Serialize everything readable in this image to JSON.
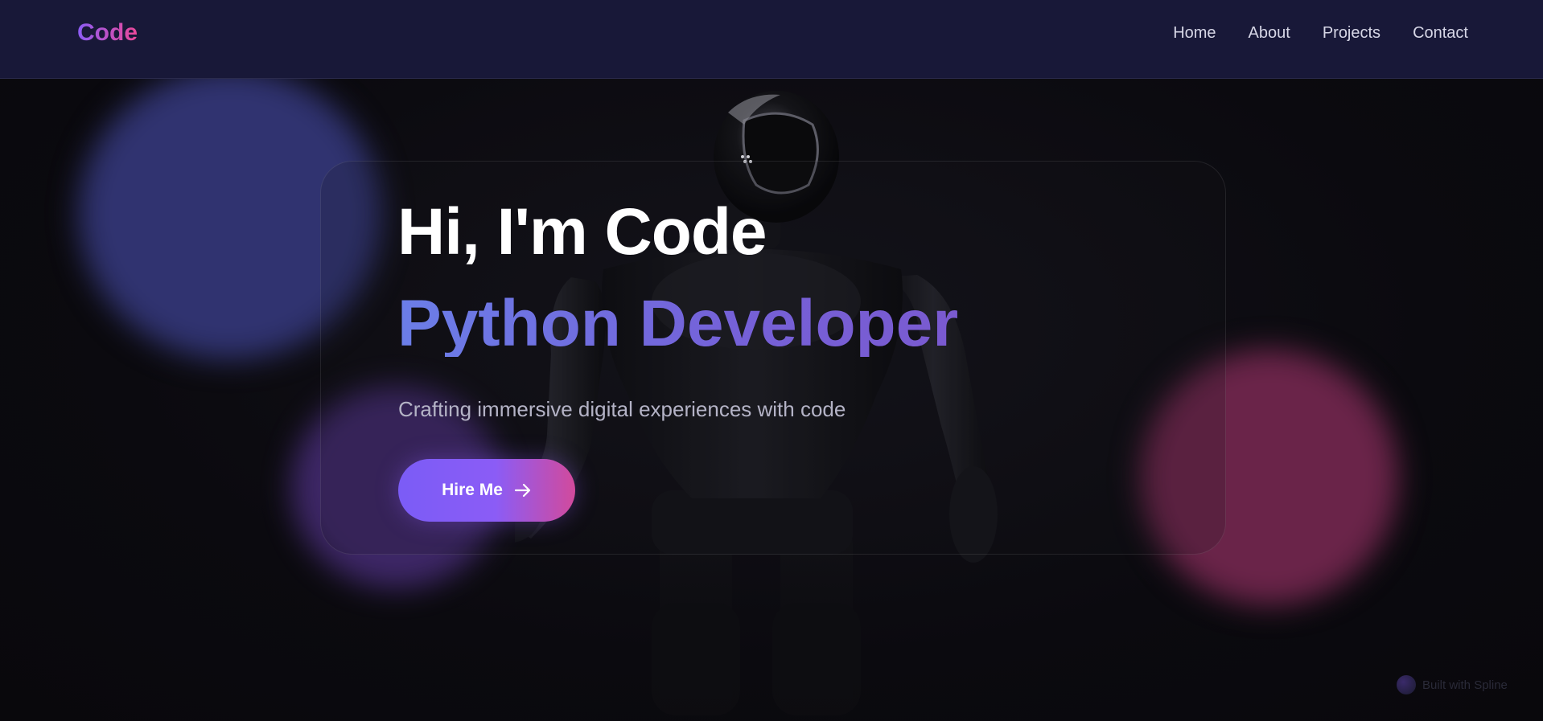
{
  "nav": {
    "logo": "Code",
    "links": [
      "Home",
      "About",
      "Projects",
      "Contact"
    ]
  },
  "hero": {
    "title": "Hi, I'm Code",
    "subtitle": "Python Developer",
    "tagline": "Crafting immersive digital experiences with code",
    "button_label": "Hire Me",
    "button_icon": "arrow-right-icon"
  },
  "footer_badge": {
    "text": "Built with Spline",
    "icon": "spline-logo-icon"
  },
  "colors": {
    "navbar_bg": "#181838",
    "page_bg": "#0b0a0f",
    "accent_purple": "#8b5cf6",
    "accent_pink": "#ec4899",
    "subtitle_blue": "#6b7ee8",
    "orb_blue": "#303370",
    "orb_purple": "#432a70",
    "orb_pink": "#6a2449"
  }
}
